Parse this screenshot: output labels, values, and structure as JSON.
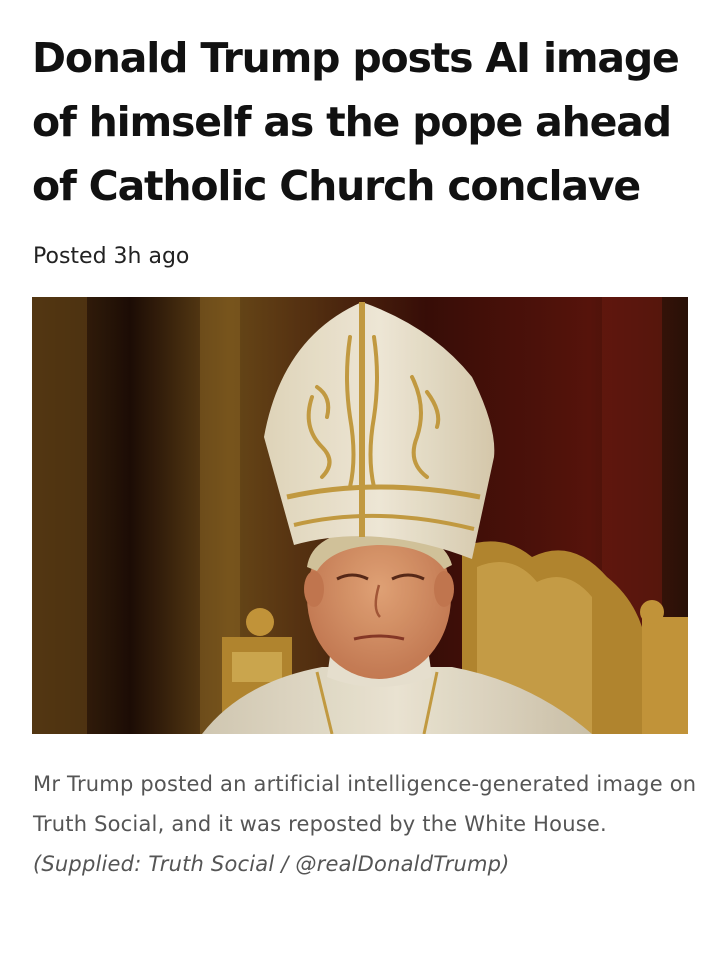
{
  "article": {
    "headline": "Donald Trump posts AI image of himself as the pope ahead of Catholic Church conclave",
    "posted": "Posted 3h ago",
    "image": {
      "subject": "ai-generated-pope-portrait-icon"
    },
    "caption": {
      "text": "Mr Trump posted an artificial intelligence-generated image on Truth Social, and it was reposted by the White House.",
      "credit": "(Supplied: Truth Social / @realDonaldTrump)"
    }
  },
  "colors": {
    "headline": "#111111",
    "caption": "#555555",
    "gold": "#c9a043",
    "robe": "#efe8d6"
  }
}
